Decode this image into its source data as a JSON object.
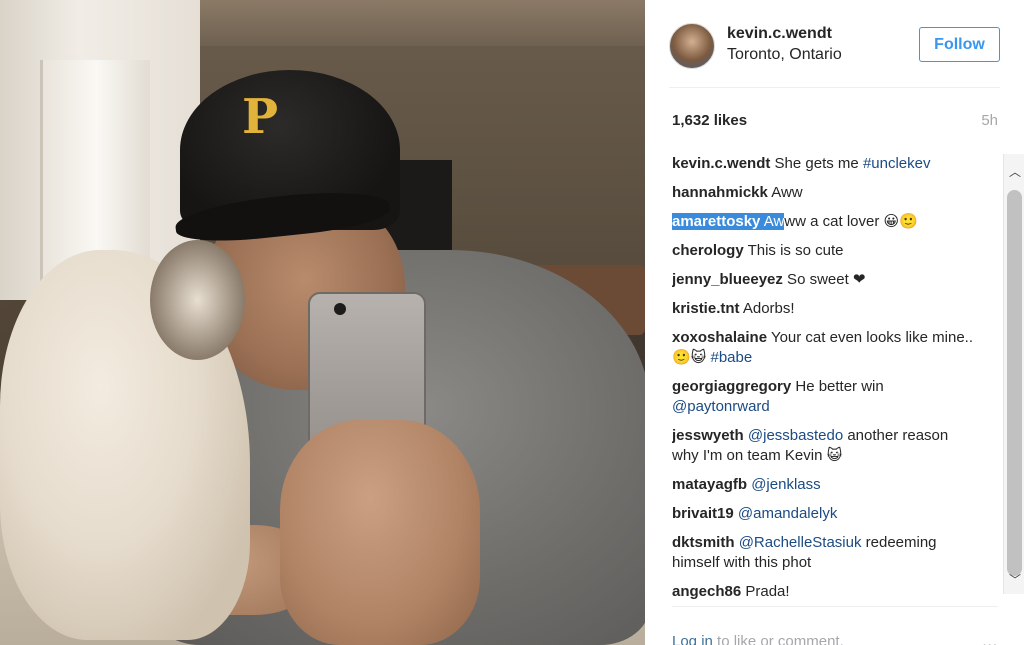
{
  "header": {
    "username": "kevin.c.wendt",
    "location": "Toronto, Ontario",
    "follow_label": "Follow"
  },
  "stats": {
    "likes": "1,632 likes",
    "time_ago": "5h"
  },
  "comments": [
    {
      "user": "kevin.c.wendt",
      "parts": [
        {
          "t": " She gets me "
        },
        {
          "t": "#unclekev",
          "k": "tag"
        }
      ]
    },
    {
      "user": "hannahmickk",
      "parts": [
        {
          "t": " Aww"
        }
      ]
    },
    {
      "user": "amarettosky",
      "selected": true,
      "parts": [
        {
          "t": " Aw",
          "k": "hl"
        },
        {
          "t": "ww a cat lover 😀🙂"
        }
      ]
    },
    {
      "user": "cherology",
      "parts": [
        {
          "t": " This is so cute"
        }
      ]
    },
    {
      "user": "jenny_blueeyez",
      "parts": [
        {
          "t": " So sweet ❤"
        }
      ]
    },
    {
      "user": "kristie.tnt",
      "parts": [
        {
          "t": " Adorbs!"
        }
      ]
    },
    {
      "user": "xoxoshalaine",
      "parts": [
        {
          "t": " Your cat even looks like mine.. 🙂😺 "
        },
        {
          "t": "#babe",
          "k": "tag"
        }
      ]
    },
    {
      "user": "georgiaggregory",
      "parts": [
        {
          "t": " He better win "
        },
        {
          "t": "@paytonrward",
          "k": "mention"
        }
      ]
    },
    {
      "user": "jesswyeth",
      "parts": [
        {
          "t": " "
        },
        {
          "t": "@jessbastedo",
          "k": "mention"
        },
        {
          "t": " another reason why I'm on team Kevin 😺"
        }
      ]
    },
    {
      "user": "matayagfb",
      "parts": [
        {
          "t": " "
        },
        {
          "t": "@jenklass",
          "k": "mention"
        }
      ]
    },
    {
      "user": "brivait19",
      "parts": [
        {
          "t": " "
        },
        {
          "t": "@amandalelyk",
          "k": "mention"
        }
      ]
    },
    {
      "user": "dktsmith",
      "parts": [
        {
          "t": " "
        },
        {
          "t": "@RachelleStasiuk",
          "k": "mention"
        },
        {
          "t": " redeeming himself with this phot"
        }
      ]
    },
    {
      "user": "angech86",
      "parts": [
        {
          "t": " Prada!"
        }
      ]
    }
  ],
  "footer": {
    "login_link": "Log in",
    "login_rest": " to like or comment.",
    "more": "..."
  },
  "colors": {
    "accent": "#3897f0",
    "hashtag": "#1c4b84",
    "selection": "#3a8bdc"
  },
  "icons": {
    "scroll_up": "chevron-up-icon",
    "scroll_down": "chevron-down-icon",
    "more": "more-dots-icon"
  }
}
